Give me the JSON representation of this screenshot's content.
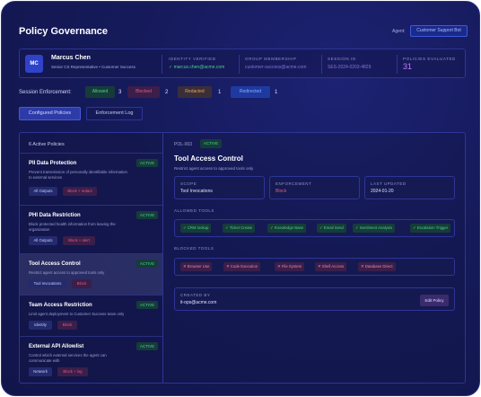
{
  "header": {
    "title": "Policy Governance",
    "agent_label": "Agent:",
    "agent_value": "Customer Support Bot"
  },
  "user": {
    "initials": "MC",
    "name": "Marcus Chen",
    "role": "Senior CS Representative  •  Customer Success",
    "identity_label": "IDENTITY VERIFIED",
    "identity_value": "✓ marcus.chen@acme.com",
    "group_label": "GROUP MEMBERSHIP",
    "group_value": "customer-success@acme.com",
    "session_label": "SESSION ID",
    "session_value": "SES-2024-0203-4829",
    "policies_label": "POLICIES EVALUATED",
    "policies_value": "31"
  },
  "enforcement": {
    "label": "Session Enforcement:",
    "allowed_label": "Allowed",
    "allowed_count": "3",
    "blocked_label": "Blocked",
    "blocked_count": "2",
    "redacted_label": "Redacted",
    "redacted_count": "1",
    "redirected_label": "Redirected",
    "redirected_count": "1"
  },
  "tabs": {
    "configured": "Configured Policies",
    "log": "Enforcement Log"
  },
  "policy_list": {
    "header": "6 Active Policies",
    "items": [
      {
        "name": "PII Data Protection",
        "desc": "Prevent transmission of personally identifiable information to external services",
        "status": "ACTIVE",
        "scope": "All Outputs",
        "action": "Block + redact"
      },
      {
        "name": "PHI Data Restriction",
        "desc": "Block protected health information from leaving the organization",
        "status": "ACTIVE",
        "scope": "All Outputs",
        "action": "Block + alert"
      },
      {
        "name": "Tool Access Control",
        "desc": "Restrict agent access to approved tools only",
        "status": "ACTIVE",
        "scope": "Tool Invocations",
        "action": "Block"
      },
      {
        "name": "Team Access Restriction",
        "desc": "Limit agent deployment to Customer Success team only",
        "status": "ACTIVE",
        "scope": "Identity",
        "action": "Block"
      },
      {
        "name": "External API Allowlist",
        "desc": "Control which external services the agent can communicate with",
        "status": "ACTIVE",
        "scope": "Network",
        "action": "Block + log"
      }
    ]
  },
  "detail": {
    "id": "POL-003",
    "status": "ACTIVE",
    "title": "Tool Access Control",
    "desc": "Restrict agent access to approved tools only",
    "scope_label": "SCOPE",
    "scope_value": "Tool Invocations",
    "enforcement_label": "ENFORCEMENT",
    "enforcement_value": "Block",
    "updated_label": "LAST UPDATED",
    "updated_value": "2024-01-20",
    "allowed_label": "ALLOWED TOOLS",
    "allowed_tools": [
      "✓ CRM lookup",
      "✓ Ticket Create",
      "✓ Knowledge Base",
      "✓ Email Send",
      "✓ Sentiment Analysis",
      "✓ Escalation Trigger"
    ],
    "blocked_label": "BLOCKED TOOLS",
    "blocked_tools": [
      "✕ Browser Use",
      "✕ Code Execution",
      "✕ File System",
      "✕ Shell Access",
      "✕ Database Direct"
    ],
    "created_label": "CREATED BY",
    "created_value": "it-ops@acme.com",
    "edit_label": "Edit Policy"
  }
}
